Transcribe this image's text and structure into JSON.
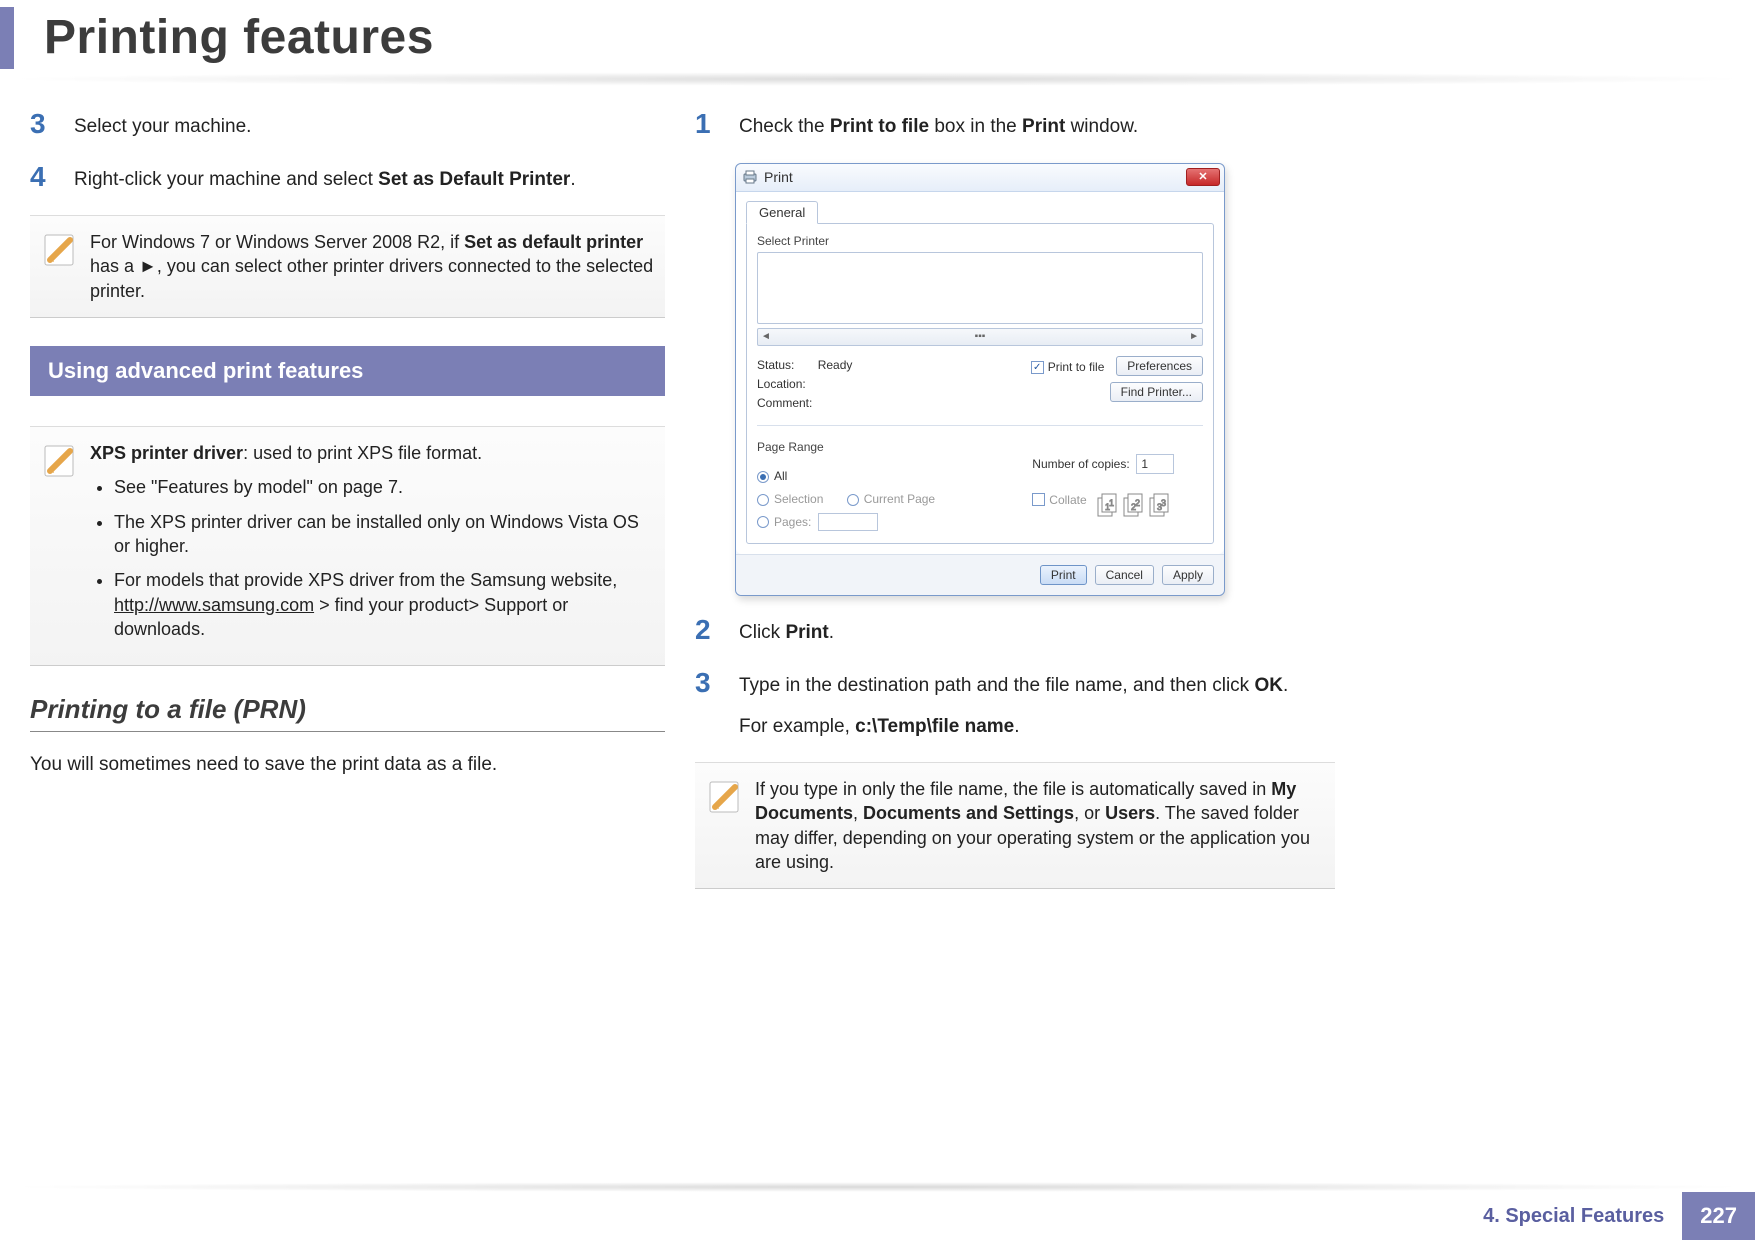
{
  "header": {
    "title": "Printing features"
  },
  "left": {
    "step3": {
      "num": "3",
      "text": "Select your machine."
    },
    "step4": {
      "num": "4",
      "prefix": "Right-click your machine and select ",
      "bold": "Set as Default Printer",
      "suffix": "."
    },
    "note1": {
      "prefix": "For Windows 7 or Windows Server 2008 R2, if ",
      "bold": "Set as default printer",
      "middle": " has a ►, you can select other printer drivers connected to the selected printer."
    },
    "section_bar": "Using advanced print features",
    "note2": {
      "bold": "XPS printer driver",
      "desc": ": used to print XPS file format.",
      "bullet1": "See \"Features by model\" on page 7.",
      "bullet2": "The XPS printer driver can be installed only on Windows Vista OS or higher.",
      "bullet3_prefix": "For models that provide XPS driver from the Samsung website, ",
      "bullet3_link": "http://www.samsung.com",
      "bullet3_suffix": "  > find your product> Support or downloads."
    },
    "subsection": "Printing to a file (PRN)",
    "body": "You will sometimes need to save the print data as a file."
  },
  "right": {
    "step1": {
      "num": "1",
      "prefix": "Check the ",
      "bold1": "Print to file",
      "mid": " box in the ",
      "bold2": "Print",
      "suffix": " window."
    },
    "dialog": {
      "title": "Print",
      "tab": "General",
      "select_printer": "Select Printer",
      "scroll_left": "◄",
      "scroll_thumb": "▪▪▪",
      "scroll_right": "►",
      "status_label": "Status:",
      "status_value": "Ready",
      "location_label": "Location:",
      "comment_label": "Comment:",
      "print_to_file": "Print to file",
      "preferences": "Preferences",
      "find_printer": "Find Printer...",
      "page_range": "Page Range",
      "all": "All",
      "selection": "Selection",
      "current_page": "Current Page",
      "pages": "Pages:",
      "num_copies_label": "Number of copies:",
      "num_copies_value": "1",
      "collate": "Collate",
      "print_btn": "Print",
      "cancel_btn": "Cancel",
      "apply_btn": "Apply"
    },
    "step2": {
      "num": "2",
      "prefix": "Click ",
      "bold": "Print",
      "suffix": "."
    },
    "step3": {
      "num": "3",
      "prefix": "Type in the destination path and the file name, and then click ",
      "bold": "OK",
      "suffix": ".",
      "sub_prefix": "For example, ",
      "sub_bold": "c:\\Temp\\file name",
      "sub_suffix": "."
    },
    "note3": {
      "p1": "If you type in only the file name, the file is automatically saved in ",
      "b1": "My Documents",
      "c1": ", ",
      "b2": "Documents and Settings",
      "c2": ", or ",
      "b3": "Users",
      "p2": ". The saved folder may differ, depending on your operating system or the application you are using."
    }
  },
  "footer": {
    "chapter": "4.  Special Features",
    "page": "227"
  }
}
